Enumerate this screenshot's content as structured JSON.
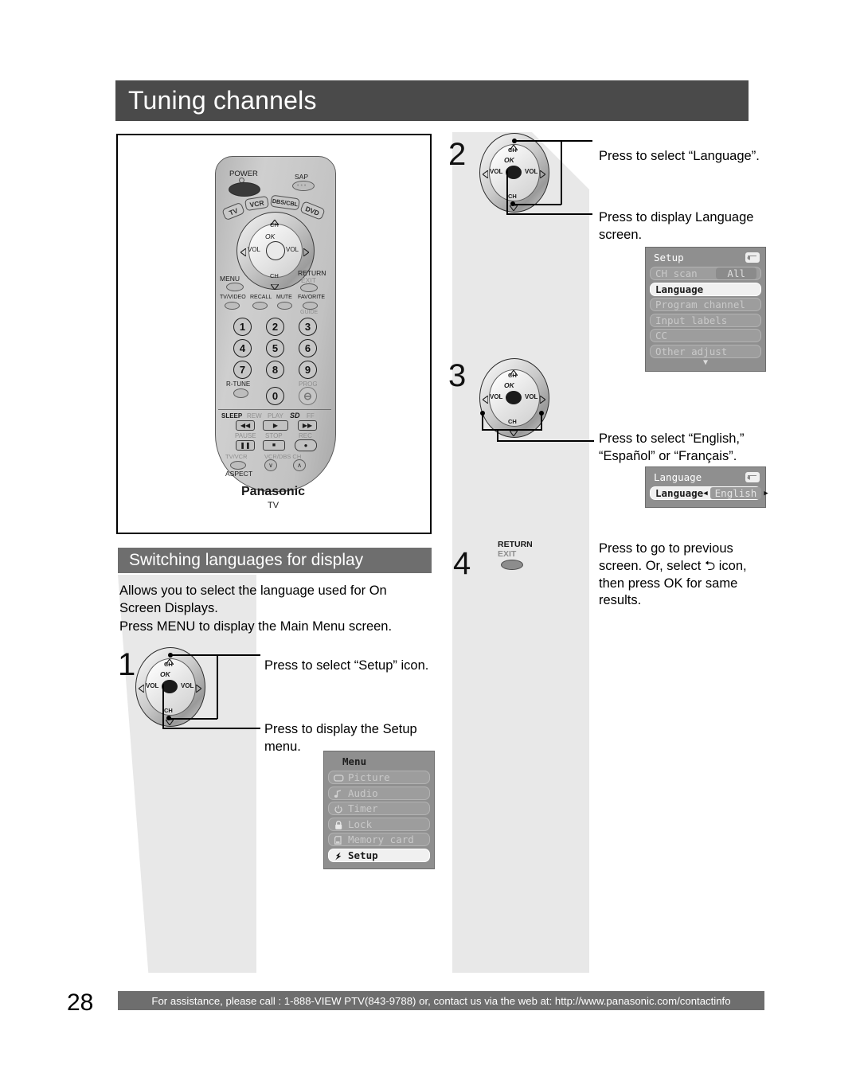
{
  "page": {
    "title": "Tuning channels",
    "number": "28"
  },
  "footer": {
    "text": "For assistance, please call : 1-888-VIEW PTV(843-9788) or, contact us via the web at: http://www.panasonic.com/contactinfo"
  },
  "section": {
    "title": "Switching languages for display",
    "intro": "Allows you to select the language used for On\nScreen Displays.",
    "intro2": "Press MENU to display the Main Menu screen."
  },
  "steps": {
    "one": "1",
    "two": "2",
    "three": "3",
    "four": "4"
  },
  "captions": {
    "step1_a": "Press to select “Setup” icon.",
    "step1_b": "Press to display the Setup\nmenu.",
    "step2_a": "Press to select “Language”.",
    "step2_b": "Press to display Language\nscreen.",
    "step3_a": "Press to select “English,”\n“Español” or “Français”.",
    "step4_a": "Press to go to previous\nscreen. Or, select ⮌ icon,\nthen press OK for same\nresults."
  },
  "navpad": {
    "ch_up": "CH",
    "ch_down": "CH",
    "ok": "OK",
    "vol_left": "VOL",
    "vol_right": "VOL"
  },
  "return_button": {
    "label_top": "RETURN",
    "label_bottom": "EXIT"
  },
  "remote": {
    "power": "POWER",
    "sap": "SAP",
    "mode_buttons": [
      "TV",
      "VCR",
      "DBS/CBL",
      "DVD"
    ],
    "menu": "MENU",
    "return": "RETURN",
    "exit": "EXIT",
    "ch_up": "CH",
    "ch_down": "CH",
    "ok": "OK",
    "vol_left": "VOL",
    "vol_right": "VOL",
    "row_labels": [
      "TV/VIDEO",
      "RECALL",
      "MUTE",
      "FAVORITE"
    ],
    "guide": "GUIDE",
    "numbers": [
      "1",
      "2",
      "3",
      "4",
      "5",
      "6",
      "7",
      "8",
      "9",
      "0"
    ],
    "r_tune": "R-TUNE",
    "prog": "PROG",
    "transport_labels": [
      "SLEEP",
      "REW",
      "PLAY",
      "SD",
      "FF"
    ],
    "transport_labels2": [
      "PAUSE",
      "STOP",
      "REC"
    ],
    "tv_vcr": "TV/VCR",
    "vcr_dbs_ch": "VCR/DBS CH",
    "aspect": "ASPECT",
    "brand": "Panasonic",
    "device": "TV"
  },
  "osd_setup": {
    "title": "Setup",
    "rows": [
      {
        "label": "CH scan",
        "value": "All",
        "selected": false,
        "has_value": true
      },
      {
        "label": "Language",
        "value": "",
        "selected": true,
        "has_value": false
      },
      {
        "label": "Program channel",
        "value": "",
        "selected": false,
        "has_value": false
      },
      {
        "label": "Input labels",
        "value": "",
        "selected": false,
        "has_value": false
      },
      {
        "label": "CC",
        "value": "",
        "selected": false,
        "has_value": false
      },
      {
        "label": "Other adjust",
        "value": "",
        "selected": false,
        "has_value": false
      }
    ],
    "scroll_arrow": "▼"
  },
  "osd_language": {
    "title": "Language",
    "row_label": "Language",
    "row_value": "English",
    "arrow_left": "◀",
    "arrow_right": "▶"
  },
  "osd_menu": {
    "title": "Menu",
    "items": [
      {
        "label": "Picture",
        "icon": "picture-icon",
        "selected": false
      },
      {
        "label": "Audio",
        "icon": "audio-note-icon",
        "selected": false
      },
      {
        "label": "Timer",
        "icon": "power-timer-icon",
        "selected": false
      },
      {
        "label": "Lock",
        "icon": "padlock-icon",
        "selected": false
      },
      {
        "label": "Memory card",
        "icon": "memory-card-icon",
        "selected": false
      },
      {
        "label": "Setup",
        "icon": "setup-wrench-icon",
        "selected": true
      }
    ]
  },
  "colors": {
    "header_bar": "#4a4a4a",
    "section_bar": "#6e6e6e",
    "slab": "#e8e8e8",
    "osd_bg": "#8f8f8f"
  }
}
